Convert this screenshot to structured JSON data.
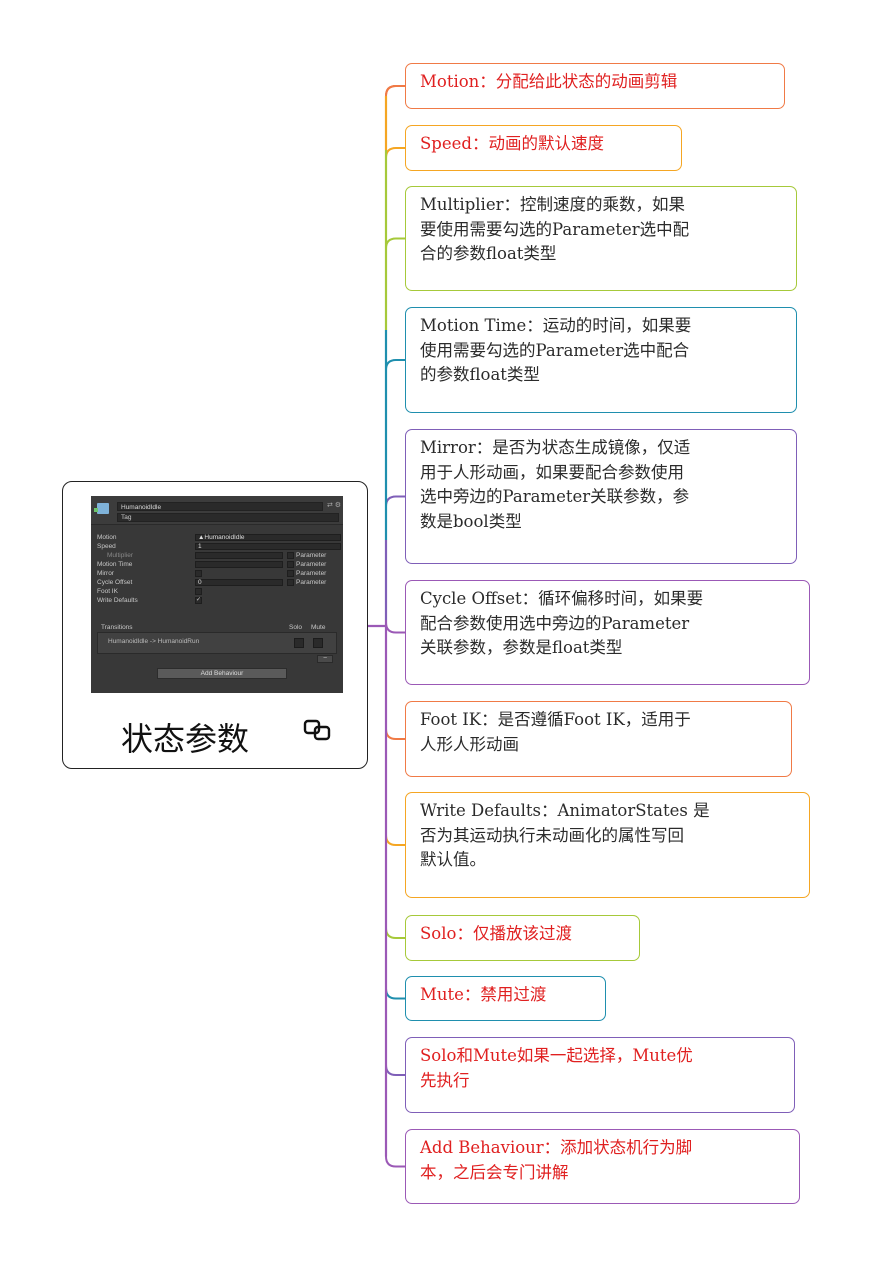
{
  "root": {
    "title": "状态参数",
    "link_icon": "link-icon",
    "inspector": {
      "object_name": "HumanoidIdle",
      "tag_label": "Tag",
      "rows": [
        {
          "label": "Motion",
          "value": "▲HumanoidIdle"
        },
        {
          "label": "Speed",
          "value": "1"
        },
        {
          "label": "Multiplier",
          "value": "",
          "parameter_label": "Parameter"
        },
        {
          "label": "Motion Time",
          "value": "",
          "parameter_label": "Parameter"
        },
        {
          "label": "Mirror",
          "value": "",
          "parameter_label": "Parameter"
        },
        {
          "label": "Cycle Offset",
          "value": "0",
          "parameter_label": "Parameter"
        },
        {
          "label": "Foot IK",
          "value": ""
        },
        {
          "label": "Write Defaults",
          "value": "✓"
        }
      ],
      "transitions_label": "Transitions",
      "solo_label": "Solo",
      "mute_label": "Mute",
      "transition_item": "HumanoidIdle -> HumanoidRun",
      "minus_label": "−",
      "add_behaviour_label": "Add Behaviour"
    }
  },
  "nodes": [
    {
      "lines": [
        "Motion：分配给此状态的动画剪辑"
      ],
      "text_color": "#e02020",
      "border_color": "#f07a46"
    },
    {
      "lines": [
        "Speed：动画的默认速度"
      ],
      "text_color": "#e02020",
      "border_color": "#f5a623"
    },
    {
      "lines": [
        "Multiplier：控制速度的乘数，如果",
        "要使用需要勾选的Parameter选中配",
        "合的参数float类型"
      ],
      "text_color": "#2b2b2b",
      "border_color": "#a6c93a"
    },
    {
      "lines": [
        "Motion Time：运动的时间，如果要",
        "使用需要勾选的Parameter选中配合",
        "的参数float类型"
      ],
      "text_color": "#2b2b2b",
      "border_color": "#1f8fae"
    },
    {
      "lines": [
        "Mirror：是否为状态生成镜像，仅适",
        "用于人形动画，如果要配合参数使用",
        "选中旁边的Parameter关联参数，参",
        "数是bool类型"
      ],
      "text_color": "#2b2b2b",
      "border_color": "#7f5fb8"
    },
    {
      "lines": [
        "Cycle Offset：循环偏移时间，如果要",
        "配合参数使用选中旁边的Parameter",
        "关联参数，参数是float类型"
      ],
      "text_color": "#2b2b2b",
      "border_color": "#9b59b6"
    },
    {
      "lines": [
        "Foot IK：是否遵循Foot IK，适用于",
        "人形人形动画"
      ],
      "text_color": "#2b2b2b",
      "border_color": "#f07a46"
    },
    {
      "lines": [
        "Write Defaults：AnimatorStates 是",
        "否为其运动执行未动画化的属性写回",
        "默认值。"
      ],
      "text_color": "#2b2b2b",
      "border_color": "#f5a623"
    },
    {
      "lines": [
        "Solo：仅播放该过渡"
      ],
      "text_color": "#e02020",
      "border_color": "#a6c93a"
    },
    {
      "lines": [
        "Mute：禁用过渡"
      ],
      "text_color": "#e02020",
      "border_color": "#1f8fae"
    },
    {
      "lines": [
        "Solo和Mute如果一起选择，Mute优",
        "先执行"
      ],
      "text_color": "#e02020",
      "border_color": "#7f5fb8"
    },
    {
      "lines": [
        "Add Behaviour：添加状态机行为脚",
        "本，之后会专门讲解"
      ],
      "text_color": "#e02020",
      "border_color": "#9b59b6"
    }
  ]
}
